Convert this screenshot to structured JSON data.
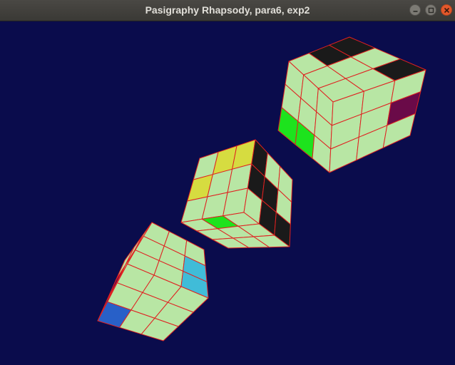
{
  "window": {
    "title": "Pasigraphy Rhapsody, para6, exp2",
    "controls": [
      "minimize-icon",
      "maximize-icon",
      "close-icon"
    ]
  },
  "scene": {
    "background": "#0a0c4c",
    "sticker_edge_color": "#e02020",
    "colors": {
      "base": "#b8e6a4",
      "black": "#1a1a1a",
      "green": "#1de31d",
      "yellow": "#d6dc40",
      "blue": "#2860c8",
      "cyan": "#40bcd8",
      "purple": "#6a0a48"
    },
    "cubes": [
      "cube-right",
      "cube-middle",
      "cube-left"
    ]
  }
}
